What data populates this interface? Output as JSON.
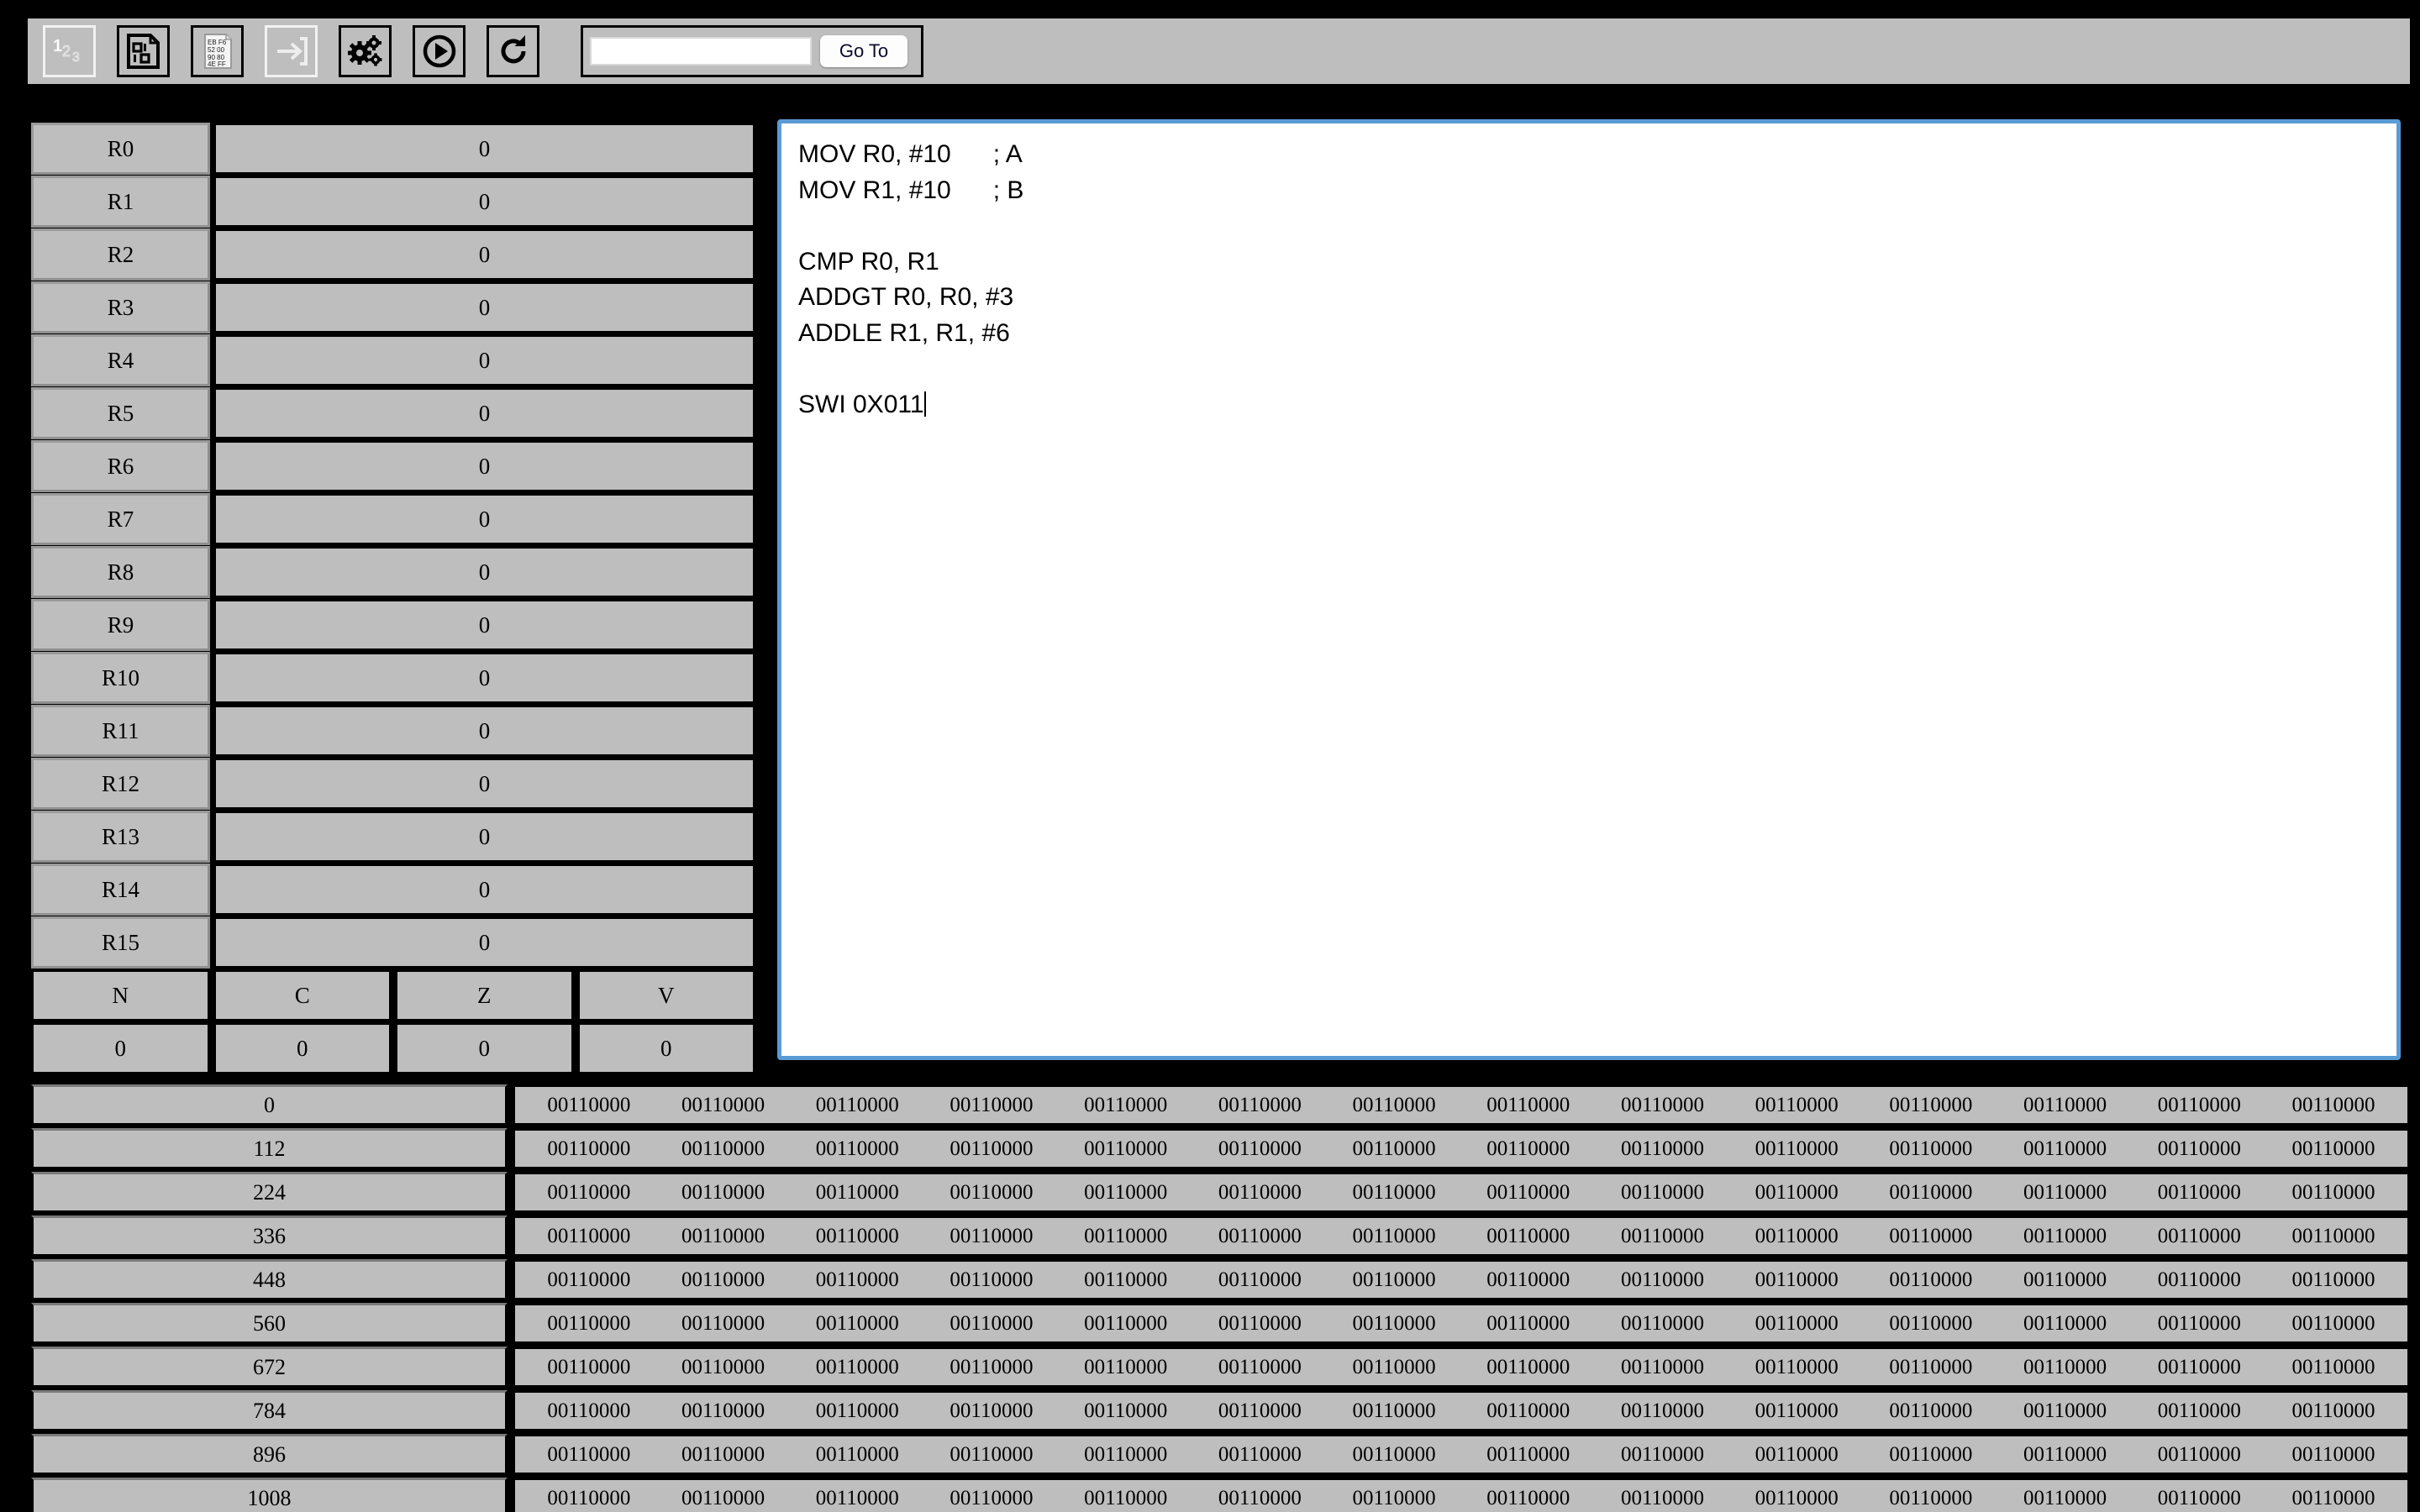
{
  "toolbar": {
    "buttons": [
      {
        "name": "decimal-view-icon",
        "label": "123",
        "disabled": true
      },
      {
        "name": "binary-view-icon",
        "label": "01 10",
        "disabled": false
      },
      {
        "name": "hex-dump-icon",
        "label": "EB F6 52 00 90 80 4E FF",
        "disabled": false
      },
      {
        "name": "step-into-icon",
        "label": "Step",
        "disabled": true
      },
      {
        "name": "settings-gears-icon",
        "label": "Settings",
        "disabled": false
      },
      {
        "name": "run-play-icon",
        "label": "Run",
        "disabled": false
      },
      {
        "name": "reset-refresh-icon",
        "label": "Reset",
        "disabled": false
      }
    ],
    "goto": {
      "value": "",
      "placeholder": "",
      "button_label": "Go To"
    }
  },
  "registers": {
    "rows": [
      {
        "name": "R0",
        "value": "0"
      },
      {
        "name": "R1",
        "value": "0"
      },
      {
        "name": "R2",
        "value": "0"
      },
      {
        "name": "R3",
        "value": "0"
      },
      {
        "name": "R4",
        "value": "0"
      },
      {
        "name": "R5",
        "value": "0"
      },
      {
        "name": "R6",
        "value": "0"
      },
      {
        "name": "R7",
        "value": "0"
      },
      {
        "name": "R8",
        "value": "0"
      },
      {
        "name": "R9",
        "value": "0"
      },
      {
        "name": "R10",
        "value": "0"
      },
      {
        "name": "R11",
        "value": "0"
      },
      {
        "name": "R12",
        "value": "0"
      },
      {
        "name": "R13",
        "value": "0"
      },
      {
        "name": "R14",
        "value": "0"
      },
      {
        "name": "R15",
        "value": "0"
      }
    ],
    "flags": {
      "names": [
        "N",
        "C",
        "Z",
        "V"
      ],
      "values": [
        "0",
        "0",
        "0",
        "0"
      ]
    }
  },
  "editor": {
    "code": "MOV R0, #10      ; A\nMOV R1, #10      ; B\n\nCMP R0, R1\nADDGT R0, R0, #3\nADDLE R1, R1, #6\n\nSWI 0X011",
    "focused": true,
    "border_color": "#5b9bd5"
  },
  "memory": {
    "addresses": [
      "0",
      "112",
      "224",
      "336",
      "448",
      "560",
      "672",
      "784",
      "896",
      "1008"
    ],
    "word_value": "00110000",
    "words_per_row": 14
  },
  "colors": {
    "background": "#000000",
    "panel": "#bebebe",
    "editor_bg": "#ffffff",
    "focus_border": "#5b9bd5"
  }
}
